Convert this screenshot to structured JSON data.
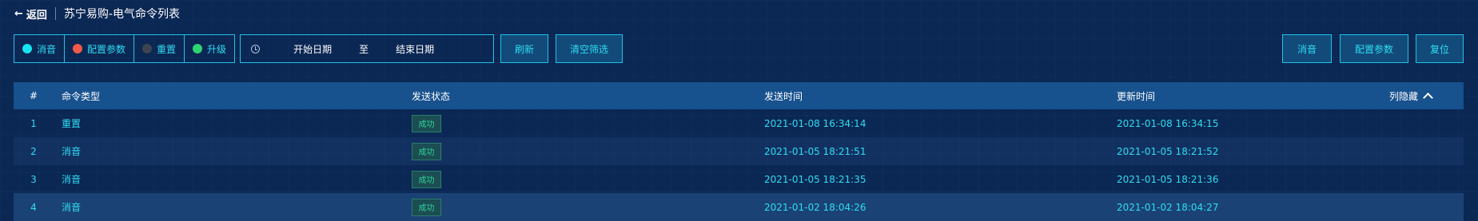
{
  "header": {
    "back_label": "返回",
    "title": "苏宁易购-电气命令列表"
  },
  "filters": [
    {
      "label": "消音",
      "color": "#17e3f3"
    },
    {
      "label": "配置参数",
      "color": "#f15a4a"
    },
    {
      "label": "重置",
      "color": "#3d4550"
    },
    {
      "label": "升级",
      "color": "#2ed573"
    }
  ],
  "date_range": {
    "start_placeholder": "开始日期",
    "separator": "至",
    "end_placeholder": "结束日期"
  },
  "toolbar": {
    "refresh_label": "刷新",
    "clear_label": "清空筛选"
  },
  "actions": {
    "mute_label": "消音",
    "config_label": "配置参数",
    "reset_label": "复位"
  },
  "table": {
    "columns": {
      "index": "#",
      "type": "命令类型",
      "status": "发送状态",
      "sent_time": "发送时间",
      "updated_time": "更新时间"
    },
    "column_toggle": "列隐藏",
    "rows": [
      {
        "index": "1",
        "type": "重置",
        "status": "成功",
        "sent_time": "2021-01-08 16:34:14",
        "updated_time": "2021-01-08 16:34:15"
      },
      {
        "index": "2",
        "type": "消音",
        "status": "成功",
        "sent_time": "2021-01-05 18:21:51",
        "updated_time": "2021-01-05 18:21:52"
      },
      {
        "index": "3",
        "type": "消音",
        "status": "成功",
        "sent_time": "2021-01-05 18:21:35",
        "updated_time": "2021-01-05 18:21:36"
      },
      {
        "index": "4",
        "type": "消音",
        "status": "成功",
        "sent_time": "2021-01-02 18:04:26",
        "updated_time": "2021-01-02 18:04:27"
      }
    ]
  }
}
